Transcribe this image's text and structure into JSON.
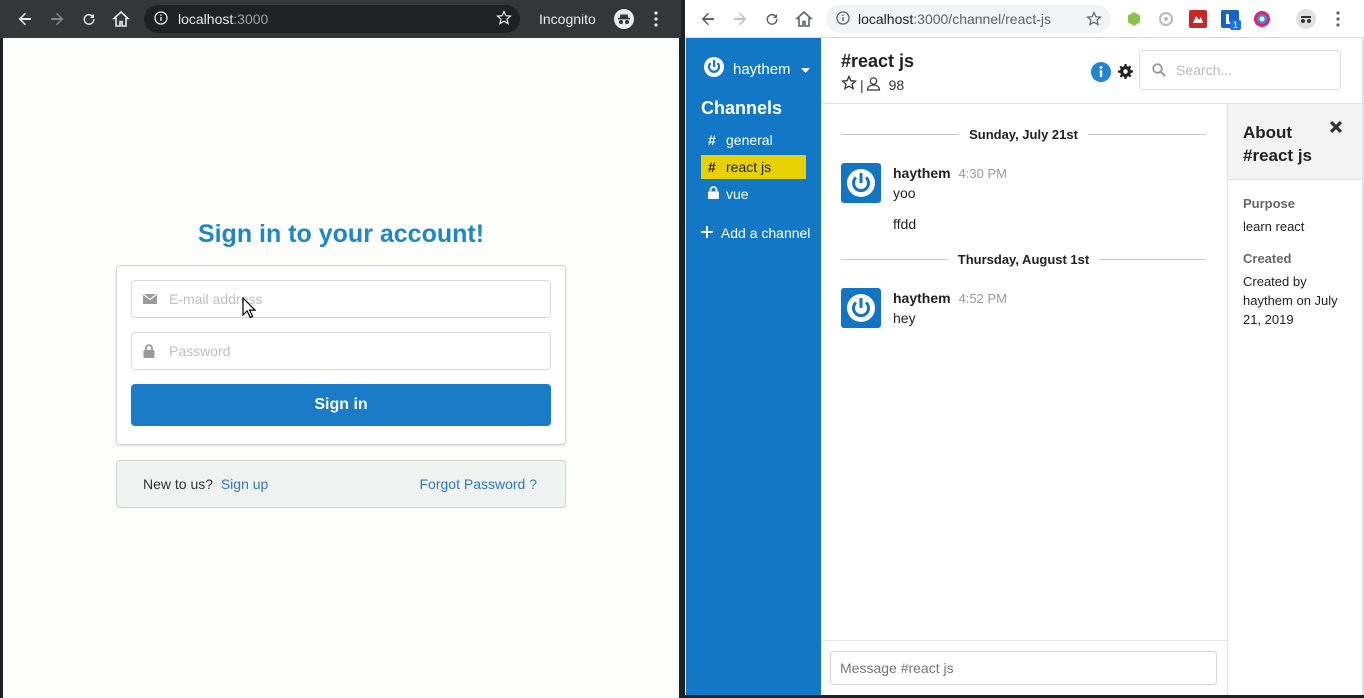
{
  "left_window": {
    "url_host": "localhost",
    "url_path": ":3000",
    "incognito_label": "Incognito",
    "signin": {
      "title": "Sign in to your account!",
      "email_placeholder": "E-mail address",
      "password_placeholder": "Password",
      "button": "Sign in",
      "new_to_us": "New to us?",
      "sign_up": "Sign up",
      "forgot": "Forgot Password ?"
    }
  },
  "right_window": {
    "url_host": "localhost",
    "url_path": ":3000/channel/react-js",
    "extension_badge": "1",
    "app": {
      "team_name": "haythem",
      "channels_heading": "Channels",
      "channels": [
        {
          "symbol": "#",
          "name": "general",
          "active": false
        },
        {
          "symbol": "#",
          "name": "react js",
          "active": true
        },
        {
          "symbol": "lock",
          "name": "vue",
          "active": false
        }
      ],
      "add_channel": "Add a channel",
      "header": {
        "channel_title": "#react js",
        "member_count": "98",
        "search_placeholder": "Search..."
      },
      "days": [
        {
          "label": "Sunday, July 21st",
          "messages": [
            {
              "user": "haythem",
              "time": "4:30 PM",
              "lines": [
                "yoo",
                "ffdd"
              ]
            }
          ]
        },
        {
          "label": "Thursday, August 1st",
          "messages": [
            {
              "user": "haythem",
              "time": "4:52 PM",
              "lines": [
                "hey"
              ]
            }
          ]
        }
      ],
      "composer_placeholder": "Message #react js",
      "about": {
        "title": "About #react js",
        "purpose_label": "Purpose",
        "purpose_value": "learn react",
        "created_label": "Created",
        "created_value": "Created by haythem on July 21, 2019"
      }
    }
  },
  "colors": {
    "sidebar": "#1278c6",
    "active_channel": "#e7d003",
    "primary_button": "#1a7bc7",
    "title_blue": "#1e86c8"
  }
}
